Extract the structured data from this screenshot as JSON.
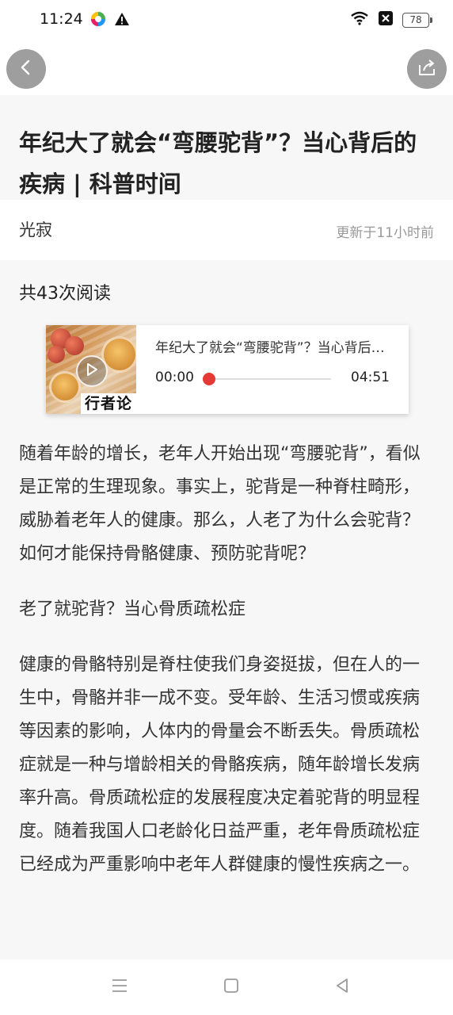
{
  "status_bar": {
    "time": "11:24",
    "battery": "78",
    "icons": [
      "app-notification-icon",
      "warning-icon",
      "wifi-icon",
      "close-box-icon",
      "battery-icon"
    ]
  },
  "nav": {
    "back_icon": "chevron-left-icon",
    "share_icon": "share-icon"
  },
  "article": {
    "title": "年纪大了就会“弯腰驼背”？当心背后的疾病 | 科普时间",
    "author": "光寂",
    "updated": "更新于11小时前",
    "read_count": "共43次阅读",
    "paragraphs": [
      "随着年龄的增长，老年人开始出现“弯腰驼背”，看似是正常的生理现象。事实上，驼背是一种脊柱畸形，威胁着老年人的健康。那么，人老了为什么会驼背？如何才能保持骨骼健康、预防驼背呢？",
      "老了就驼背？当心骨质疏松症",
      "健康的骨骼特别是脊柱使我们身姿挺拔，但在人的一生中，骨骼并非一成不变。受年龄、生活习惯或疾病等因素的影响，人体内的骨量会不断丢失。骨质疏松症就是一种与增龄相关的骨骼疾病，随年龄增长发病率升高。骨质疏松症的发展程度决定着驼背的明显程度。随着我国人口老龄化日益严重，老年骨质疏松症已经成为严重影响中老年人群健康的慢性疾病之一。"
    ]
  },
  "audio_player": {
    "title": "年纪大了就会“弯腰驼背”？当心背后的疾病 | 科普时间",
    "current_time": "00:00",
    "total_time": "04:51",
    "progress": 0.0,
    "thumbnail_caption": "行者论",
    "accent_color": "#e53935"
  },
  "bottom_nav": {
    "icons": [
      "menu-icon",
      "home-square-icon",
      "back-triangle-icon"
    ]
  }
}
